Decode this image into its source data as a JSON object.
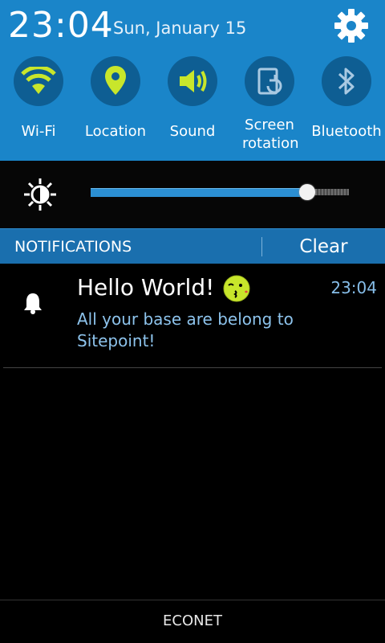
{
  "status": {
    "time": "23:04",
    "date": "Sun, January 15"
  },
  "quick_settings": [
    {
      "label": "Wi-Fi",
      "icon": "wifi-icon",
      "active": true
    },
    {
      "label": "Location",
      "icon": "location-pin-icon",
      "active": true
    },
    {
      "label": "Sound",
      "icon": "sound-icon",
      "active": true
    },
    {
      "label": "Screen rotation",
      "icon": "screen-rotation-icon",
      "active": false
    },
    {
      "label": "Bluetooth",
      "icon": "bluetooth-icon",
      "active": false
    }
  ],
  "brightness": {
    "level": 0.84,
    "icon": "brightness-icon"
  },
  "notifications_header": {
    "title": "NOTIFICATIONS",
    "clear_label": "Clear"
  },
  "notifications": [
    {
      "title": "Hello World!",
      "body": "All your base are belong to Sitepoint!",
      "time": "23:04",
      "icon": "bell-icon",
      "emoji": "kissing-face-icon"
    }
  ],
  "carrier": "ECONET",
  "colors": {
    "panel_blue": "#1a85c9",
    "toggle_active": "#c8e62b",
    "toggle_inactive": "#a9c9e2",
    "notif_header_blue": "#1a6fae",
    "body_text_blue": "#8dc3ec"
  }
}
